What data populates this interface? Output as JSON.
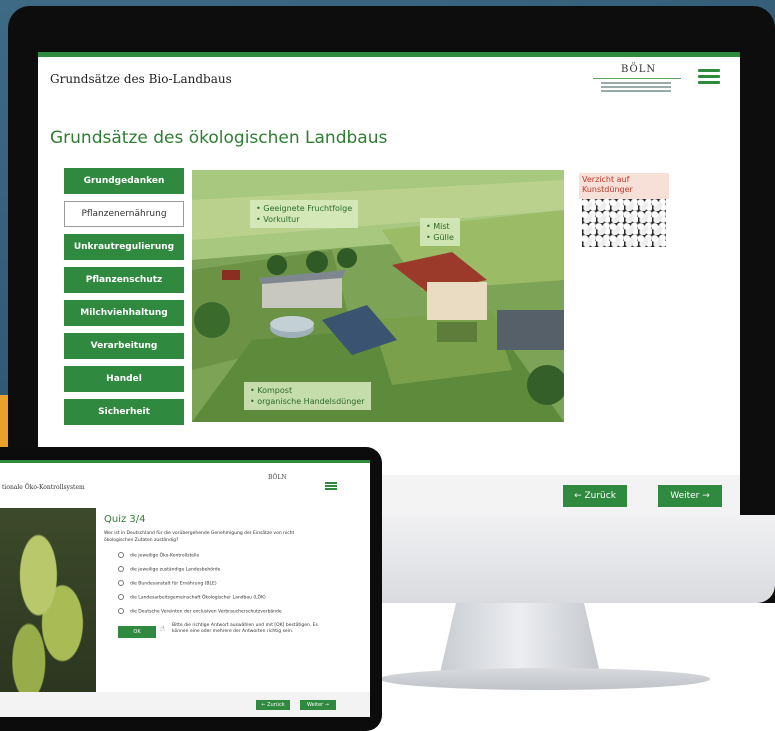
{
  "desktop": {
    "header_title": "Grundsätze des Bio-Landbaus",
    "logo_text": "BÖLN",
    "page_title": "Grundsätze des ökologischen Landbaus",
    "nav_items": [
      {
        "label": "Grundgedanken",
        "active": false
      },
      {
        "label": "Pflanzenernährung",
        "active": true
      },
      {
        "label": "Unkrautregulierung",
        "active": false
      },
      {
        "label": "Pflanzenschutz",
        "active": false
      },
      {
        "label": "Milchviehhaltung",
        "active": false
      },
      {
        "label": "Verarbeitung",
        "active": false
      },
      {
        "label": "Handel",
        "active": false
      },
      {
        "label": "Sicherheit",
        "active": false
      }
    ],
    "callouts": {
      "crops": [
        "Geeignete Fruchtfolge",
        "Vorkultur"
      ],
      "manure": [
        "Mist",
        "Gülle"
      ],
      "compost": [
        "Kompost",
        "organische Handelsdünger"
      ]
    },
    "side_card_label": "Verzicht auf Kunstdünger",
    "back_button": "← Zurück",
    "next_button": "Weiter →"
  },
  "tablet": {
    "header_title": "tionale Öko-Kontrollsystem",
    "logo_text": "BÖLN",
    "quiz_title": "Quiz 3/4",
    "question": "Wer ist in Deutschland für die vorübergehende Genehmigung der Einsätze von nicht ökologischen Zutaten zuständig?",
    "options": [
      "die jeweilige Öko-Kontrollstelle",
      "die jeweilige zuständige Landesbehörde",
      "die Bundesanstalt für Ernährung (BLE)",
      "die Landesarbeitsgemeinschaft Ökologischer Landbau (LÖK)",
      "die Deutsche Vereinten der exclusiven Verbraucherschutzverbände"
    ],
    "ok_button": "OK",
    "hint": "Bitte die richtige Antwort auswählen und mit [OK] bestätigen. Es können eine oder mehrere der Antworten richtig sein.",
    "back_button": "← Zurück",
    "next_button": "Weiter →"
  }
}
